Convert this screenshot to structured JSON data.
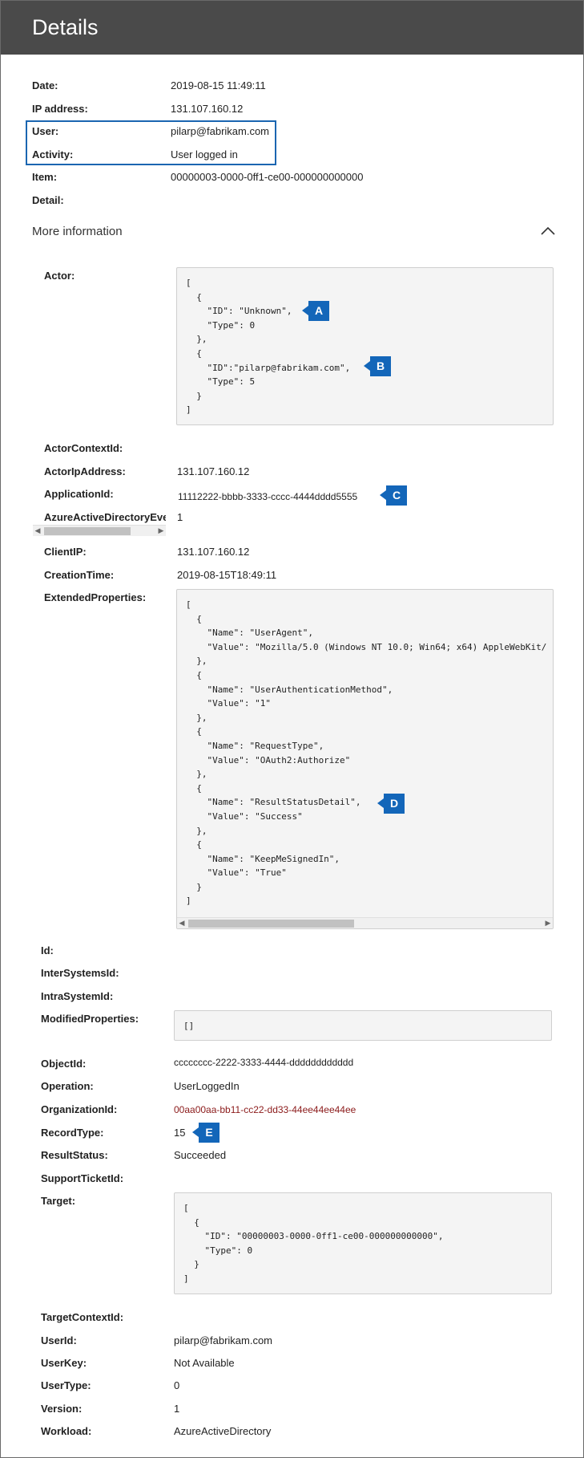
{
  "header": {
    "title": "Details"
  },
  "summary": [
    {
      "label": "Date:",
      "value": "2019-08-15 11:49:11"
    },
    {
      "label": "IP address:",
      "value": "131.107.160.12"
    },
    {
      "label": "User:",
      "value": "pilarp@fabrikam.com"
    },
    {
      "label": "Activity:",
      "value": "User logged in"
    },
    {
      "label": "Item:",
      "value": "00000003-0000-0ff1-ce00-000000000000"
    },
    {
      "label": "Detail:",
      "value": ""
    }
  ],
  "more_info": {
    "label": "More information",
    "icon": "chevron-up-icon"
  },
  "details": {
    "actor_label": "Actor:",
    "actor_code": "[\n  {\n    \"ID\": \"Unknown\",\n    \"Type\": 0\n  },\n  {\n    \"ID\":\"pilarp@fabrikam.com\",\n    \"Type\": 5\n  }\n]",
    "actor_context_id_label": "ActorContextId:",
    "actor_ip_label": "ActorIpAddress:",
    "actor_ip_value": "131.107.160.12",
    "application_id_label": "ApplicationId:",
    "application_id_value": "11112222-bbbb-3333-cccc-4444dddd5555",
    "azure_event_label": "AzureActiveDirectoryEventType:",
    "azure_event_value": "1",
    "client_ip_label": "ClientIP:",
    "client_ip_value": "131.107.160.12",
    "creation_time_label": "CreationTime:",
    "creation_time_value": "2019-08-15T18:49:11",
    "extended_label": "ExtendedProperties:",
    "extended_code": "[\n  {\n    \"Name\": \"UserAgent\",\n    \"Value\": \"Mozilla/5.0 (Windows NT 10.0; Win64; x64) AppleWebKit/\n  },\n  {\n    \"Name\": \"UserAuthenticationMethod\",\n    \"Value\": \"1\"\n  },\n  {\n    \"Name\": \"RequestType\",\n    \"Value\": \"OAuth2:Authorize\"\n  },\n  {\n    \"Name\": \"ResultStatusDetail\",\n    \"Value\": \"Success\"\n  },\n  {\n    \"Name\": \"KeepMeSignedIn\",\n    \"Value\": \"True\"\n  }\n]",
    "id_label": "Id:",
    "intersystems_label": "InterSystemsId:",
    "intrasystem_label": "IntraSystemId:",
    "modified_label": "ModifiedProperties:",
    "modified_code": "[]",
    "object_id_label": "ObjectId:",
    "object_id_value": "cccccccc-2222-3333-4444-dddddddddddd",
    "operation_label": "Operation:",
    "operation_value": "UserLoggedIn",
    "organization_label": "OrganizationId:",
    "organization_value": "00aa00aa-bb11-cc22-dd33-44ee44ee44ee",
    "record_type_label": "RecordType:",
    "record_type_value": "15",
    "result_status_label": "ResultStatus:",
    "result_status_value": "Succeeded",
    "support_ticket_label": "SupportTicketId:",
    "target_label": "Target:",
    "target_code": "[\n  {\n    \"ID\": \"00000003-0000-0ff1-ce00-000000000000\",\n    \"Type\": 0\n  }\n]",
    "target_context_label": "TargetContextId:",
    "user_id_label": "UserId:",
    "user_id_value": "pilarp@fabrikam.com",
    "user_key_label": "UserKey:",
    "user_key_value": "Not Available",
    "user_type_label": "UserType:",
    "user_type_value": "0",
    "version_label": "Version:",
    "version_value": "1",
    "workload_label": "Workload:",
    "workload_value": "AzureActiveDirectory"
  },
  "callouts": {
    "a": "A",
    "b": "B",
    "c": "C",
    "d": "D",
    "e": "E"
  },
  "colors": {
    "header_bg": "#4a4a4a",
    "accent": "#1366b9",
    "code_bg": "#f4f4f4"
  }
}
